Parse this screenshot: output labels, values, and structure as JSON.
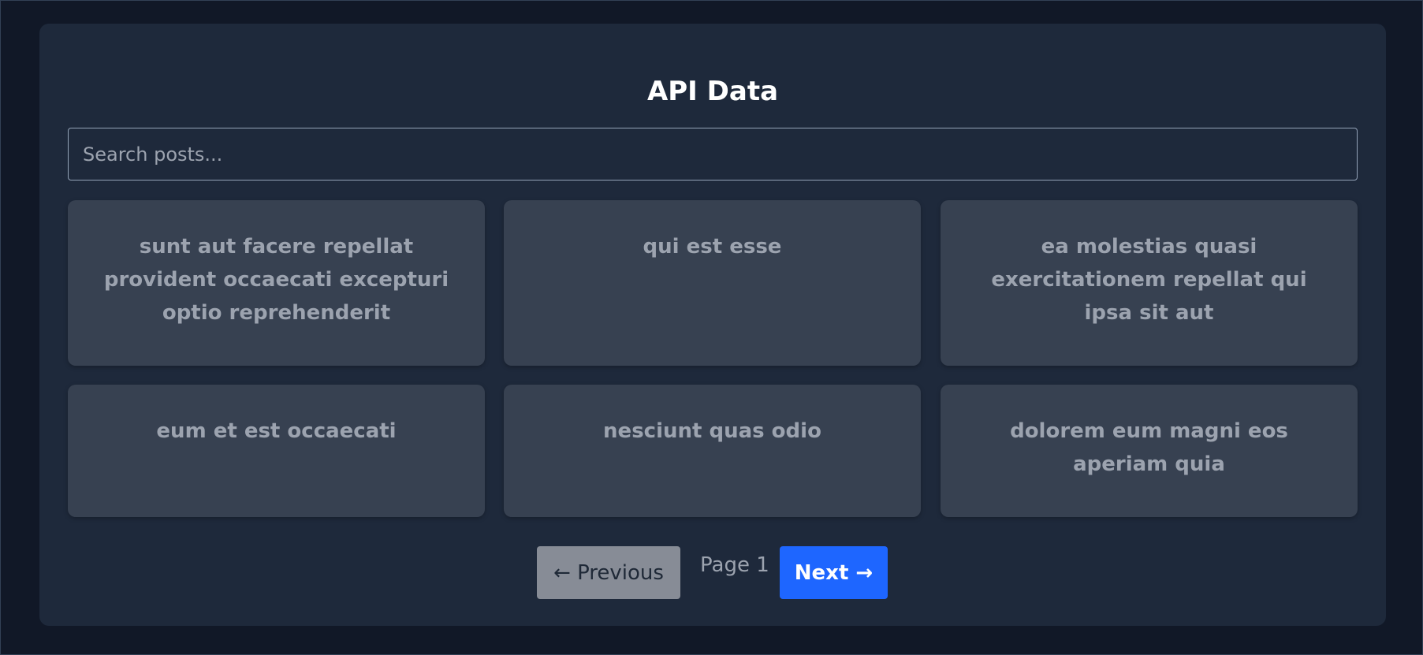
{
  "header": {
    "title": "API Data"
  },
  "search": {
    "placeholder": "Search posts...",
    "value": ""
  },
  "posts": [
    {
      "title": "sunt aut facere repellat provident occaecati excepturi optio reprehenderit"
    },
    {
      "title": "qui est esse"
    },
    {
      "title": "ea molestias quasi exercitationem repellat qui ipsa sit aut"
    },
    {
      "title": "eum et est occaecati"
    },
    {
      "title": "nesciunt quas odio"
    },
    {
      "title": "dolorem eum magni eos aperiam quia"
    }
  ],
  "pagination": {
    "previous_label": "← Previous",
    "page_label": "Page 1",
    "next_label": "Next →"
  },
  "colors": {
    "page_background": "#111827",
    "panel_background": "#1e293b",
    "card_background": "#374151",
    "card_text": "#9ca3af",
    "next_button": "#1e66ff",
    "previous_button": "#878c96"
  }
}
